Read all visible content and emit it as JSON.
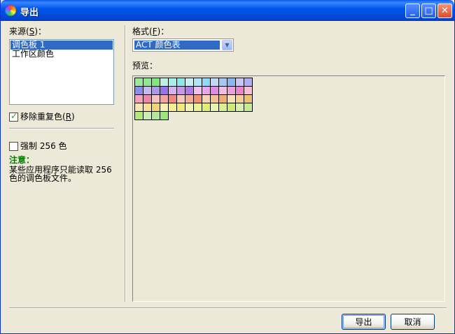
{
  "window": {
    "title": "导出",
    "buttons": {
      "minimize": "_",
      "maximize": "□",
      "close": "✕"
    }
  },
  "source": {
    "label_prefix": "来源(",
    "label_key": "S",
    "label_suffix": ")：",
    "items": [
      {
        "label": "调色板 1",
        "selected": true
      },
      {
        "label": "工作区颜色",
        "selected": false
      }
    ]
  },
  "remove_duplicates": {
    "label_prefix": "移除重复色(",
    "label_key": "R",
    "label_suffix": ")",
    "checked": true
  },
  "force_256": {
    "label": "强制 256 色",
    "checked": false
  },
  "note": {
    "title": "注意：",
    "line1": "某些应用程序只能读取 256",
    "line2": "色的调色板文件。"
  },
  "format": {
    "label_prefix": "格式(",
    "label_key": "F",
    "label_suffix": ")：",
    "selected": "ACT 颜色表"
  },
  "preview": {
    "label": "预览：",
    "swatch_colors": [
      "#9de89d",
      "#8fe88f",
      "#7fe77f",
      "#bfeee5",
      "#a8efe8",
      "#8de8e8",
      "#c8eef5",
      "#b0e4f7",
      "#93d8f5",
      "#bfd8f5",
      "#a6c7f3",
      "#8bb6f0",
      "#c8c8f2",
      "#b0aef1",
      "#8c8cef",
      "#c3b8ef",
      "#aa98ec",
      "#9574e8",
      "#d8b2ef",
      "#c797ec",
      "#b079e7",
      "#efbfef",
      "#e8a6ec",
      "#e08ae6",
      "#f2bde2",
      "#ef9fd8",
      "#e985cb",
      "#f5bfd0",
      "#f2a2bb",
      "#ee86a5",
      "#f5c3c0",
      "#f2a4a1",
      "#ee8683",
      "#f5c8b8",
      "#f2ad94",
      "#ee9271",
      "#f5d4b4",
      "#f2c094",
      "#eeab72",
      "#f5dfb4",
      "#f2cf94",
      "#eec074",
      "#f7e8b2",
      "#f5e095",
      "#f1d676",
      "#f7f2b0",
      "#f5ee93",
      "#f2e977",
      "#f2f5b2",
      "#eaf293",
      "#e1ee74",
      "#e7f3b0",
      "#d9ef93",
      "#cbeb76",
      "#d8f0b0",
      "#c6ec93",
      "#b4e878",
      "#c8eeb2",
      "#b2e996",
      "#9be57c"
    ]
  },
  "actions": {
    "export_label": "导出",
    "cancel_label": "取消"
  }
}
